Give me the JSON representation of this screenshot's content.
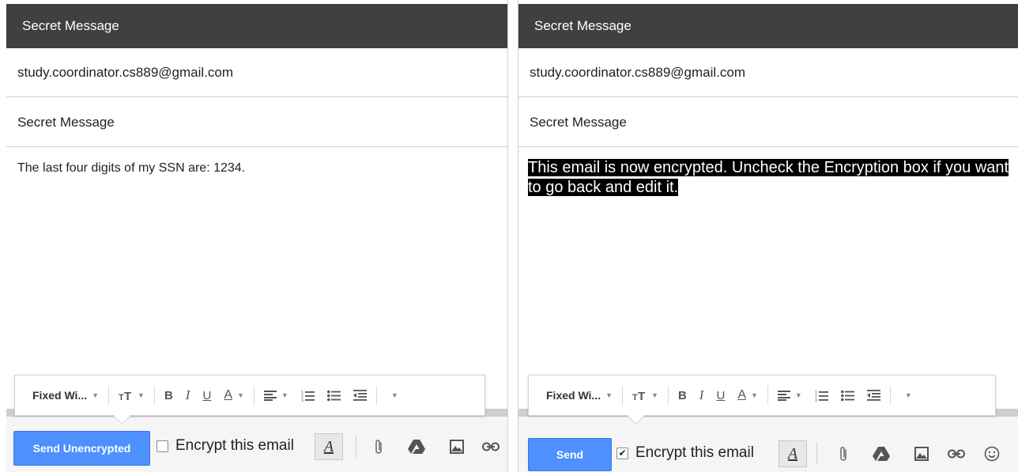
{
  "left": {
    "window_title": "Secret Message",
    "to": "study.coordinator.cs889@gmail.com",
    "subject": "Secret Message",
    "body": "The last four digits of my SSN are: 1234.",
    "toolbar": {
      "font": "Fixed Wi...",
      "bold": "B",
      "italic": "I",
      "underline": "U",
      "text_color": "A"
    },
    "send_label": "Send Unencrypted",
    "encrypt_label": "Encrypt this email",
    "encrypt_checked": false,
    "formatting_label": "A"
  },
  "right": {
    "window_title": "Secret Message",
    "to": "study.coordinator.cs889@gmail.com",
    "subject": "Secret Message",
    "body": "This email is now encrypted. Uncheck the Encryption box if you want to go back and edit it.",
    "toolbar": {
      "font": "Fixed Wi...",
      "bold": "B",
      "italic": "I",
      "underline": "U",
      "text_color": "A"
    },
    "send_label": "Send",
    "encrypt_label": "Encrypt this email",
    "encrypt_checked": true,
    "formatting_label": "A"
  },
  "colors": {
    "titlebar": "#404040",
    "send_button": "#4d90fe",
    "encrypted_highlight": "#000000"
  }
}
